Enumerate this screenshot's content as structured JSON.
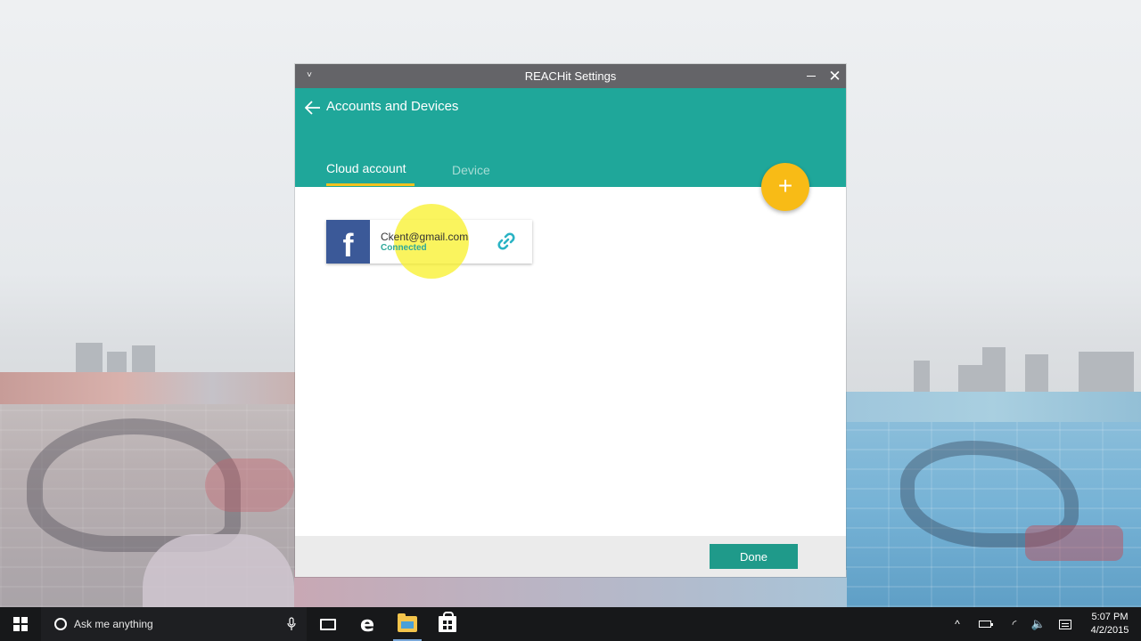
{
  "window": {
    "title": "REACHit Settings",
    "menu_glyph": "˅",
    "close_glyph": "✕"
  },
  "header": {
    "back_glyph": "←",
    "title": "Accounts and Devices",
    "tabs": [
      {
        "label": "Cloud account",
        "active": true
      },
      {
        "label": "Device",
        "active": false
      }
    ],
    "add_glyph": "+",
    "accent_color": "#1fa79a",
    "fab_color": "#f8bb16"
  },
  "accounts": [
    {
      "service_icon": "facebook-icon",
      "logo_letter": "f",
      "email": "Ckent@gmail.com",
      "status": "Connected",
      "status_icon": "link-icon"
    }
  ],
  "footer": {
    "done_label": "Done"
  },
  "taskbar": {
    "search_placeholder": "Ask me anything",
    "edge_glyph": "e",
    "tray_chevron": "^",
    "wifi_glyph": "◜",
    "volume_glyph": "🔈",
    "time": "5:07 PM",
    "date": "4/2/2015"
  }
}
